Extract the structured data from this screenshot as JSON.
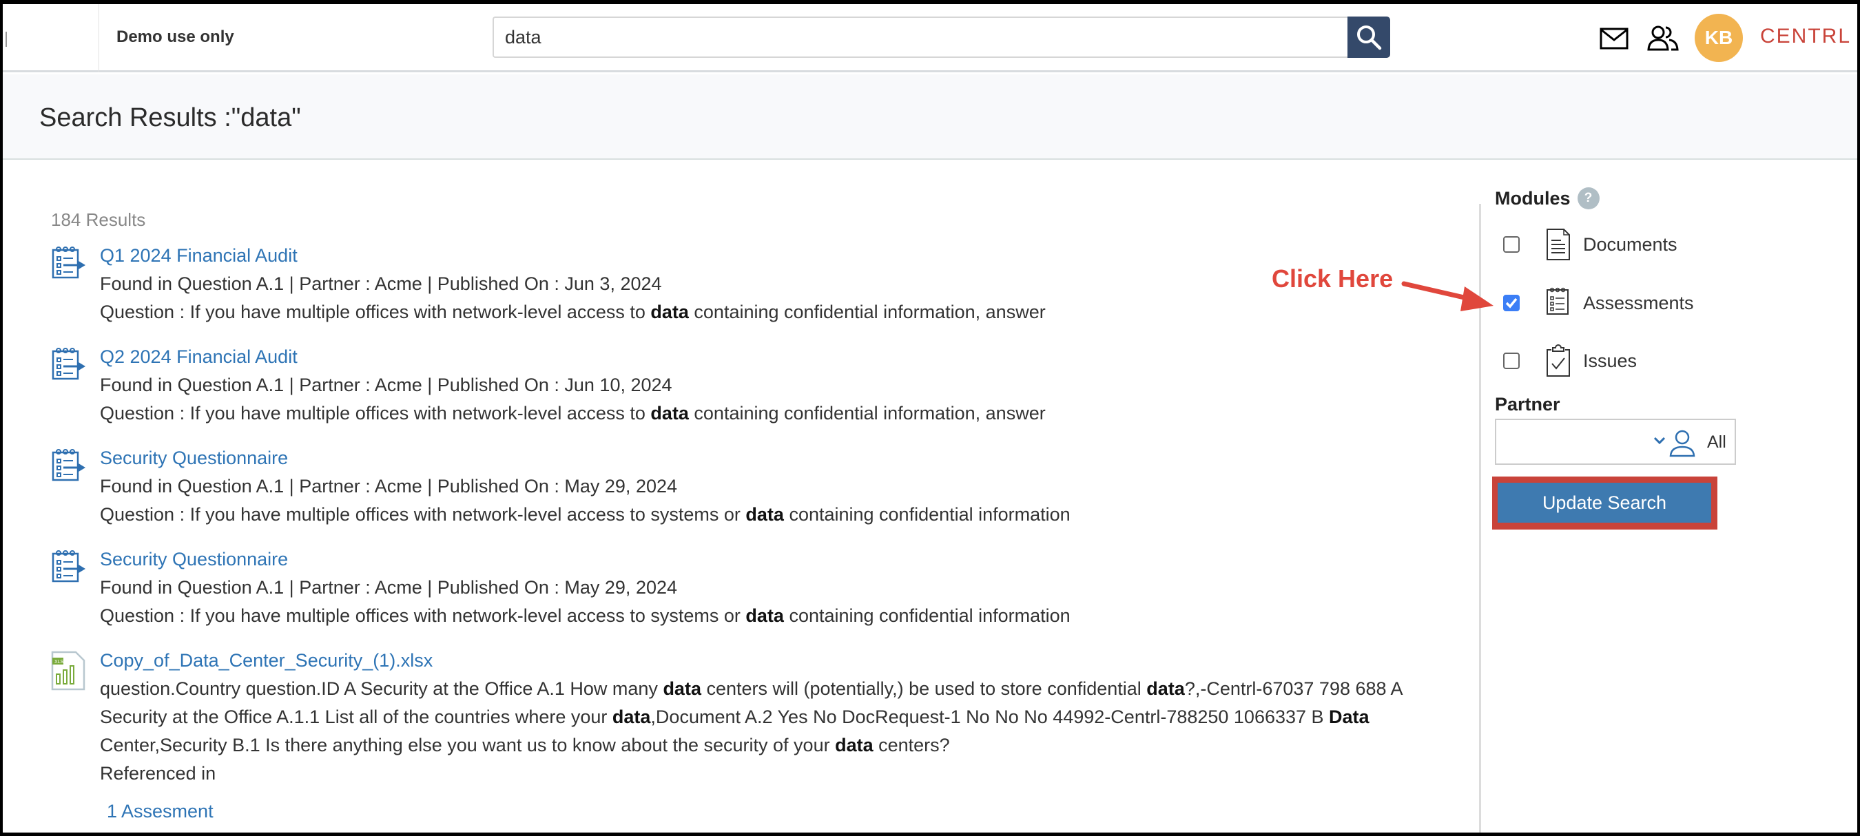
{
  "topbar": {
    "org_label": "Demo use only",
    "search_value": "data",
    "search_icon": "search-icon",
    "mail_icon": "mail-icon",
    "people_icon": "people-icon",
    "avatar_initials": "KB",
    "avatar_color": "#f2b451",
    "brand": "CENTRL",
    "brand_color": "#c9443a"
  },
  "page": {
    "title": "Search Results :\"data\"",
    "result_count": "184 Results"
  },
  "results": [
    {
      "icon": "assessment-icon",
      "title": "Q1 2024 Financial Audit",
      "lines": [
        [
          {
            "t": "Found in Question A.1 | Partner : Acme | Published On : Jun 3, 2024"
          }
        ],
        [
          {
            "t": "Question : If you have multiple offices with network-level access to "
          },
          {
            "t": "data",
            "b": true
          },
          {
            "t": " containing confidential information, answer"
          }
        ]
      ]
    },
    {
      "icon": "assessment-icon",
      "title": "Q2 2024 Financial Audit",
      "lines": [
        [
          {
            "t": "Found in Question A.1 | Partner : Acme | Published On : Jun 10, 2024"
          }
        ],
        [
          {
            "t": "Question : If you have multiple offices with network-level access to "
          },
          {
            "t": "data",
            "b": true
          },
          {
            "t": " containing confidential information, answer"
          }
        ]
      ]
    },
    {
      "icon": "assessment-icon",
      "title": "Security Questionnaire",
      "lines": [
        [
          {
            "t": "Found in Question A.1 | Partner : Acme | Published On : May 29, 2024"
          }
        ],
        [
          {
            "t": "Question : If you have multiple offices with network-level access to systems or "
          },
          {
            "t": "data",
            "b": true
          },
          {
            "t": " containing confidential information"
          }
        ]
      ]
    },
    {
      "icon": "assessment-icon",
      "title": "Security Questionnaire",
      "lines": [
        [
          {
            "t": "Found in Question A.1 | Partner : Acme | Published On : May 29, 2024"
          }
        ],
        [
          {
            "t": "Question : If you have multiple offices with network-level access to systems or "
          },
          {
            "t": "data",
            "b": true
          },
          {
            "t": " containing confidential information"
          }
        ]
      ]
    },
    {
      "icon": "xls-file-icon",
      "title": "Copy_of_Data_Center_Security_(1).xlsx",
      "lines": [
        [
          {
            "t": "question.Country question.ID A Security at the Office A.1 How many "
          },
          {
            "t": "data",
            "b": true
          },
          {
            "t": " centers will (potentially,) be used to store confidential "
          },
          {
            "t": "data",
            "b": true
          },
          {
            "t": "?,-Centrl-67037 798 688 A Security at the Office A.1.1 List all of the countries where your "
          },
          {
            "t": "data",
            "b": true
          },
          {
            "t": ",Document A.2 Yes No DocRequest-1 No No No 44992-Centrl-788250 1066337 B "
          },
          {
            "t": "Data",
            "b": true
          },
          {
            "t": " Center,Security B.1 Is there anything else you want us to know about the security of your "
          },
          {
            "t": "data",
            "b": true
          },
          {
            "t": " centers?"
          }
        ],
        [
          {
            "t": "Referenced in"
          }
        ]
      ],
      "reference_link": "1 Assesment"
    }
  ],
  "sidebar": {
    "modules_label": "Modules",
    "help_glyph": "?",
    "modules": [
      {
        "label": "Documents",
        "icon": "document-icon",
        "checked": false
      },
      {
        "label": "Assessments",
        "icon": "assessment-icon",
        "checked": true
      },
      {
        "label": "Issues",
        "icon": "clipboard-check-icon",
        "checked": false
      }
    ],
    "partner_label": "Partner",
    "partner_value": "All",
    "update_button": "Update Search",
    "button_color": "#3e7ab0",
    "highlight_color": "#c9433a"
  },
  "annotation": {
    "text": "Click Here",
    "color": "#e0473c"
  }
}
